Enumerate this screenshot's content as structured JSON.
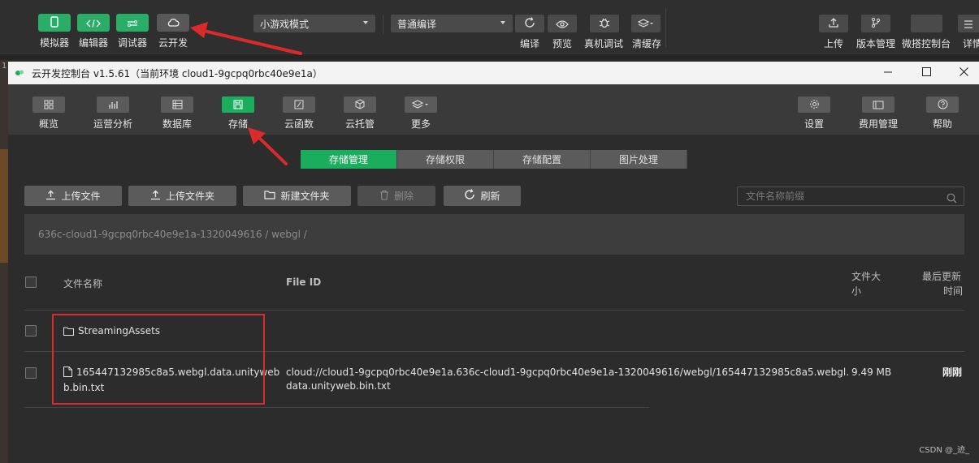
{
  "ide": {
    "left_buttons": [
      {
        "label": "模拟器",
        "icon": "phone-icon"
      },
      {
        "label": "编辑器",
        "icon": "code-icon"
      },
      {
        "label": "调试器",
        "icon": "debug-toggle-icon"
      },
      {
        "label": "云开发",
        "icon": "cloud-icon"
      }
    ],
    "mode_select": "小游戏模式",
    "compile_select": "普通编译",
    "mid_buttons": [
      {
        "label": "编译",
        "icon": "refresh-icon"
      },
      {
        "label": "预览",
        "icon": "eye-icon"
      },
      {
        "label": "真机调试",
        "icon": "bug-icon"
      },
      {
        "label": "清缓存",
        "icon": "layers-icon"
      }
    ],
    "right_buttons": [
      {
        "label": "上传",
        "icon": "upload-icon"
      },
      {
        "label": "版本管理",
        "icon": "branch-icon"
      },
      {
        "label": "微搭控制台",
        "icon": "blank-icon"
      },
      {
        "label": "详情",
        "icon": "menu-icon"
      }
    ],
    "side_marker": "1"
  },
  "window": {
    "title": "云开发控制台 v1.5.61（当前环境 cloud1-9gcpq0rbc40e9e1a）",
    "controls": [
      "minimize",
      "maximize",
      "close"
    ]
  },
  "console_toolbar": {
    "left": [
      {
        "label": "概览",
        "icon": "grid-icon"
      },
      {
        "label": "运营分析",
        "icon": "bar-chart-icon"
      },
      {
        "label": "数据库",
        "icon": "database-icon"
      },
      {
        "label": "存储",
        "icon": "storage-icon",
        "active": true
      },
      {
        "label": "云函数",
        "icon": "function-icon"
      },
      {
        "label": "云托管",
        "icon": "cube-icon"
      },
      {
        "label": "更多",
        "icon": "more-layers-icon"
      }
    ],
    "right": [
      {
        "label": "设置",
        "icon": "settings-icon"
      },
      {
        "label": "费用管理",
        "icon": "billing-icon"
      },
      {
        "label": "帮助",
        "icon": "help-icon"
      }
    ]
  },
  "tabs": [
    {
      "label": "存储管理",
      "active": true
    },
    {
      "label": "存储权限",
      "active": false
    },
    {
      "label": "存储配置",
      "active": false
    },
    {
      "label": "图片处理",
      "active": false
    }
  ],
  "actions": {
    "upload_file": "上传文件",
    "upload_folder": "上传文件夹",
    "new_folder": "新建文件夹",
    "delete": "删除",
    "refresh": "刷新"
  },
  "search": {
    "placeholder": "文件名称前缀"
  },
  "path": "636c-cloud1-9gcpq0rbc40e9e1a-1320049616 / webgl /",
  "table": {
    "headers": {
      "name": "文件名称",
      "file_id": "File ID",
      "size_l1": "文件大",
      "size_l2": "小",
      "updated_l1": "最后更新",
      "updated_l2": "时间"
    },
    "rows": [
      {
        "type": "folder",
        "name": "StreamingAssets",
        "file_id": "",
        "size": "",
        "updated": ""
      },
      {
        "type": "file",
        "name_l1": "165447132985c8a5.webgl.data.unityweb",
        "name_l2": "b.bin.txt",
        "file_id_l1": "cloud://cloud1-9gcpq0rbc40e9e1a.636c-cloud1-9gcpq0rbc40e9e1a-1320049616/webgl/165447132985c8a5.webgl.",
        "file_id_l2": "data.unityweb.bin.txt",
        "size": "9.49 MB",
        "updated": "刚刚"
      }
    ]
  },
  "watermark": "CSDN @_迹_",
  "colors": {
    "accent": "#1aad5d",
    "annotation": "#d92b2b"
  }
}
